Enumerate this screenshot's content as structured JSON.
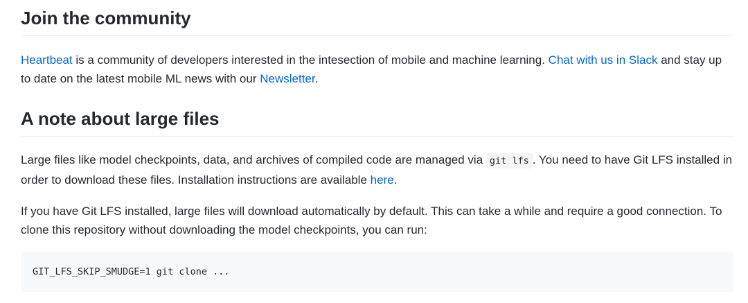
{
  "section_community": {
    "heading": "Join the community",
    "link_heartbeat": "Heartbeat",
    "text_1": " is a community of developers interested in the intesection of mobile and machine learning. ",
    "link_slack": "Chat with us in Slack",
    "text_2": " and stay up to date on the latest mobile ML news with our ",
    "link_newsletter": "Newsletter",
    "text_3": "."
  },
  "section_large_files": {
    "heading": "A note about large files",
    "para1_text_1": "Large files like model checkpoints, data, and archives of compiled code are managed via ",
    "para1_code": "git lfs",
    "para1_text_2": ". You need to have Git LFS installed in order to download these files. Installation instructions are available ",
    "para1_link_here": "here",
    "para1_text_3": ".",
    "para2_text": "If you have Git LFS installed, large files will download automatically by default. This can take a while and require a good connection. To clone this repository without downloading the model checkpoints, you can run:",
    "code_block": "GIT_LFS_SKIP_SMUDGE=1 git clone ..."
  }
}
